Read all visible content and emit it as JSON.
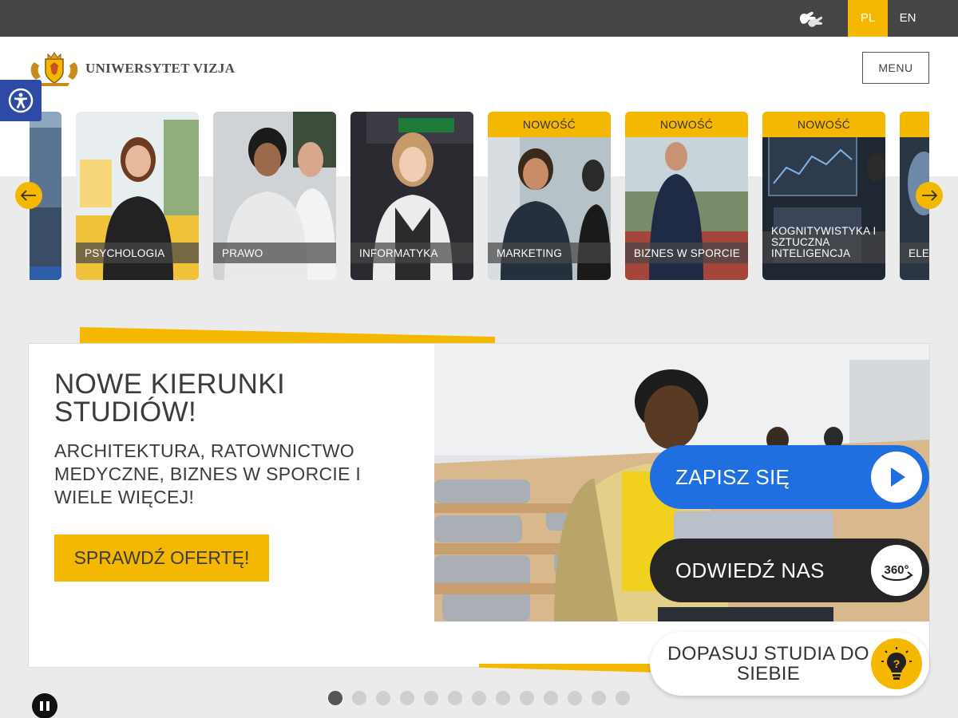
{
  "topbar": {
    "sign_language_icon": "sign-language-icon",
    "languages": [
      {
        "code": "PL",
        "active": true
      },
      {
        "code": "EN",
        "active": false
      }
    ]
  },
  "header": {
    "logo_icon": "coat-of-arms-icon",
    "brand": "UNIWERSYTET VIZJA",
    "menu_label": "MENU"
  },
  "accessibility": {
    "icon": "accessibility-icon"
  },
  "programs": [
    {
      "label": "",
      "badge": ""
    },
    {
      "label": "PSYCHOLOGIA",
      "badge": ""
    },
    {
      "label": "PRAWO",
      "badge": ""
    },
    {
      "label": "INFORMATYKA",
      "badge": ""
    },
    {
      "label": "MARKETING",
      "badge": "NOWOŚĆ"
    },
    {
      "label": "BIZNES W SPORCIE",
      "badge": "NOWOŚĆ"
    },
    {
      "label": "KOGNITYWISTYKA I SZTUCZNA INTELIGENCJA",
      "badge": "NOWOŚĆ"
    },
    {
      "label": "ELE RAD",
      "badge": ""
    }
  ],
  "hero": {
    "title": "NOWE KIERUNKI STUDIÓW!",
    "subtitle": "ARCHITEKTURA, RATOWNICTWO MEDYCZNE, BIZNES W SPORCIE I WIELE WIĘCEJ!",
    "cta": "SPRAWDŹ OFERTĘ!"
  },
  "actions": {
    "signup": "ZAPISZ SIĘ",
    "visit": "ODWIEDŹ NAS",
    "visit_icon_text": "360°",
    "match": "DOPASUJ STUDIA DO SIEBIE"
  },
  "slider": {
    "total": 13,
    "active": 1
  },
  "colors": {
    "accent": "#f5b800",
    "blue": "#1f6fe0",
    "dark": "#262626",
    "topbar": "#454545"
  }
}
